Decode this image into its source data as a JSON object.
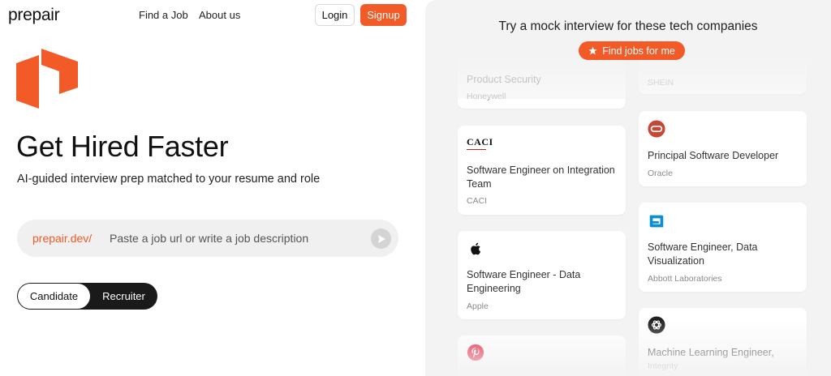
{
  "nav": {
    "logo": "prepair",
    "links": [
      "Find a Job",
      "About us"
    ],
    "login_label": "Login",
    "signup_label": "Signup"
  },
  "hero": {
    "title": "Get Hired Faster",
    "subtitle": "AI-guided interview prep matched to your resume and role"
  },
  "search": {
    "prefix": "prepair.dev/",
    "placeholder": "Paste a job url or write a job description"
  },
  "mode_toggle": {
    "options": [
      "Candidate",
      "Recruiter"
    ],
    "selected": "Candidate"
  },
  "panel": {
    "title": "Try a mock interview for these tech companies",
    "find_jobs_label": "Find jobs for me",
    "jobs": [
      {
        "title": "Product Security",
        "company": "Honeywell",
        "logo": "none"
      },
      {
        "title": "",
        "company": "SHEIN",
        "logo": "none"
      },
      {
        "title": "Software Engineer on Integration Team",
        "company": "CACI",
        "logo": "caci-logo",
        "logo_text": "CACI"
      },
      {
        "title": "Principal Software Developer",
        "company": "Oracle",
        "logo": "oracle-icon"
      },
      {
        "title": "Software Engineer, Data Visualization",
        "company": "Abbott Laboratories",
        "logo": "abbott-icon"
      },
      {
        "title": "Software Engineer - Data Engineering",
        "company": "Apple",
        "logo": "apple-icon"
      },
      {
        "title": "Machine Learning Engineer,",
        "company": "Integrity",
        "logo": "openai-icon"
      },
      {
        "title": "",
        "company": "",
        "logo": "pinterest-icon"
      }
    ]
  },
  "colors": {
    "accent": "#f25a27",
    "dark": "#1a1a1a",
    "panel_bg": "#f3f3f3"
  }
}
